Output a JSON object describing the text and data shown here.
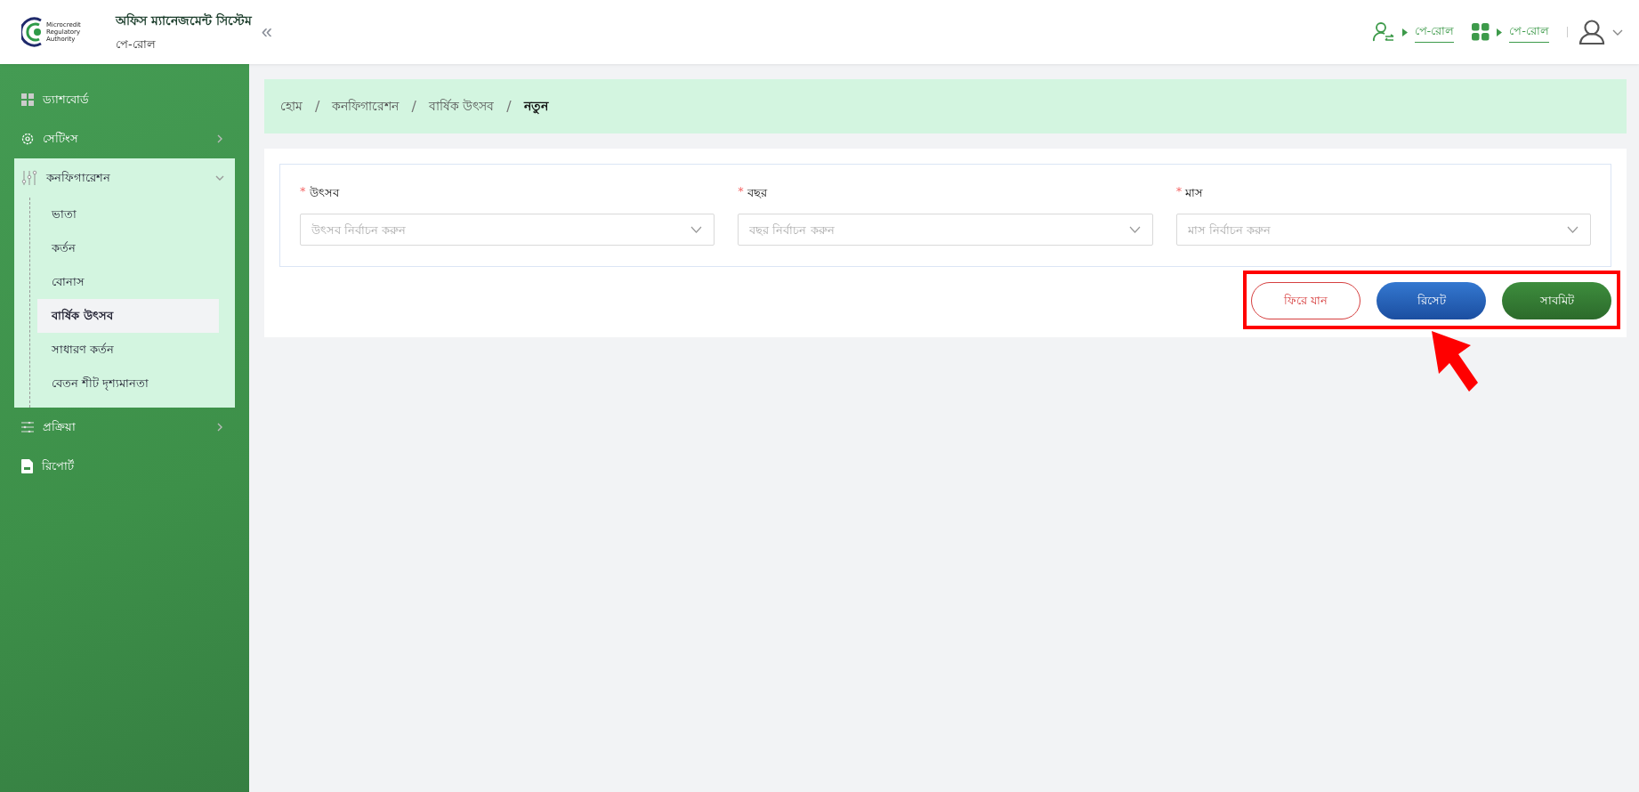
{
  "header": {
    "logo_text": [
      "Microcredit",
      "Regulatory",
      "Authority"
    ],
    "title": "অফিস ম্যানেজমেন্ট সিস্টেম",
    "subtitle": "পে-রোল",
    "collapse": "«",
    "links": [
      {
        "label": "পে-রোল"
      },
      {
        "label": "পে-রোল"
      }
    ]
  },
  "sidebar": {
    "items": [
      {
        "label": "ড্যাশবোর্ড",
        "expandable": false,
        "expanded": false
      },
      {
        "label": "সেটিংস",
        "expandable": true,
        "expanded": false
      },
      {
        "label": "কনফিগারেশন",
        "expandable": true,
        "expanded": true,
        "children": [
          {
            "label": "ভাতা",
            "selected": false
          },
          {
            "label": "কর্তন",
            "selected": false
          },
          {
            "label": "বোনাস",
            "selected": false
          },
          {
            "label": "বার্ষিক উৎসব",
            "selected": true
          },
          {
            "label": "সাধারণ কর্তন",
            "selected": false
          },
          {
            "label": "বেতন শীট দৃশ্যমানতা",
            "selected": false
          }
        ]
      },
      {
        "label": "প্রক্রিয়া",
        "expandable": true,
        "expanded": false
      },
      {
        "label": "রিপোর্ট",
        "expandable": false,
        "expanded": false
      }
    ]
  },
  "breadcrumb": {
    "separator": "/",
    "items": [
      "হোম",
      "কনফিগারেশন",
      "বার্ষিক উৎসব",
      "নতুন"
    ]
  },
  "form": {
    "fields": [
      {
        "label": "উৎসব",
        "required_mark": "*",
        "placeholder": "উৎসব নির্বাচন করুন"
      },
      {
        "label": "বছর",
        "required_mark": "*",
        "placeholder": "বছর নির্বাচন করুন"
      },
      {
        "label": "মাস",
        "required_mark": "*",
        "placeholder": "মাস নির্বাচন করুন"
      }
    ],
    "buttons": [
      {
        "label": "ফিরে যান",
        "kind": "back"
      },
      {
        "label": "রিসেট",
        "kind": "reset"
      },
      {
        "label": "সাবমিট",
        "kind": "submit"
      }
    ]
  }
}
